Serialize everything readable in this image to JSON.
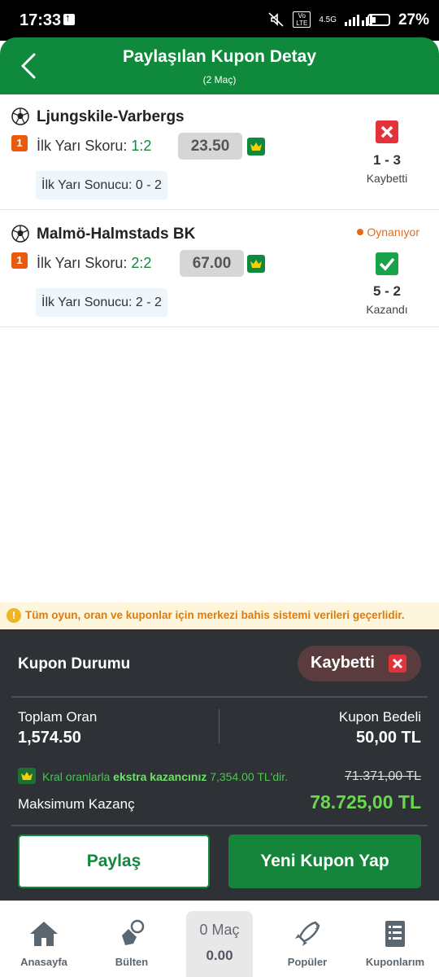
{
  "status_bar": {
    "time": "17:33",
    "network": "4.5G",
    "volte": "Vo LTE",
    "battery": "27%"
  },
  "header": {
    "title": "Paylaşılan Kupon Detay",
    "subtitle": "(2 Maç)"
  },
  "matches": [
    {
      "team": "Ljungskile-Varbergs",
      "badge": "1",
      "market": "İlk Yarı Skoru:",
      "pick": "1:2",
      "odds": "23.50",
      "result_label": "İlk Yarı Sonucu: 0 - 2",
      "score": "1 - 3",
      "outcome": "Kaybetti",
      "outcome_status": "lost",
      "live_label": ""
    },
    {
      "team": "Malmö-Halmstads BK",
      "badge": "1",
      "market": "İlk Yarı Skoru:",
      "pick": "2:2",
      "odds": "67.00",
      "result_label": "İlk Yarı Sonucu: 2 - 2",
      "score": "5 - 2",
      "outcome": "Kazandı",
      "outcome_status": "won",
      "live_label": "Oynanıyor"
    }
  ],
  "info_banner": {
    "icon": "warning-icon",
    "text": "Tüm oyun, oran ve kuponlar için merkezi bahis sistemi verileri geçerlidir."
  },
  "summary": {
    "heading": "Kupon Durumu",
    "status_label": "Kaybetti",
    "total_odds_label": "Toplam Oran",
    "total_odds": "1,574.50",
    "stake_label": "Kupon Bedeli",
    "stake": "50,00 TL",
    "extra_prefix": "Kral oranlarla",
    "extra_highlight": "ekstra kazancınız",
    "extra_suffix": "7,354.00 TL'dir.",
    "old_amount": "71.371,00 TL",
    "max_label": "Maksimum Kazanç",
    "max_value": "78.725,00 TL",
    "share_button": "Paylaş",
    "new_coupon_button": "Yeni Kupon Yap"
  },
  "bottom_nav": {
    "items": [
      {
        "label": "Anasayfa",
        "icon": "home-icon"
      },
      {
        "label": "Bülten",
        "icon": "hand-ball-icon"
      },
      {
        "label": "Popüler",
        "icon": "rocket-icon"
      },
      {
        "label": "Kuponlarım",
        "icon": "clipboard-list-icon"
      }
    ],
    "center_line1": "0 Maç",
    "center_line2": "0.00"
  },
  "colors": {
    "brand_green": "#0f8a3c",
    "lost_red": "#e2333b",
    "won_green": "#18a24a",
    "live_orange": "#e46a18",
    "summary_bg": "#2e3236"
  }
}
